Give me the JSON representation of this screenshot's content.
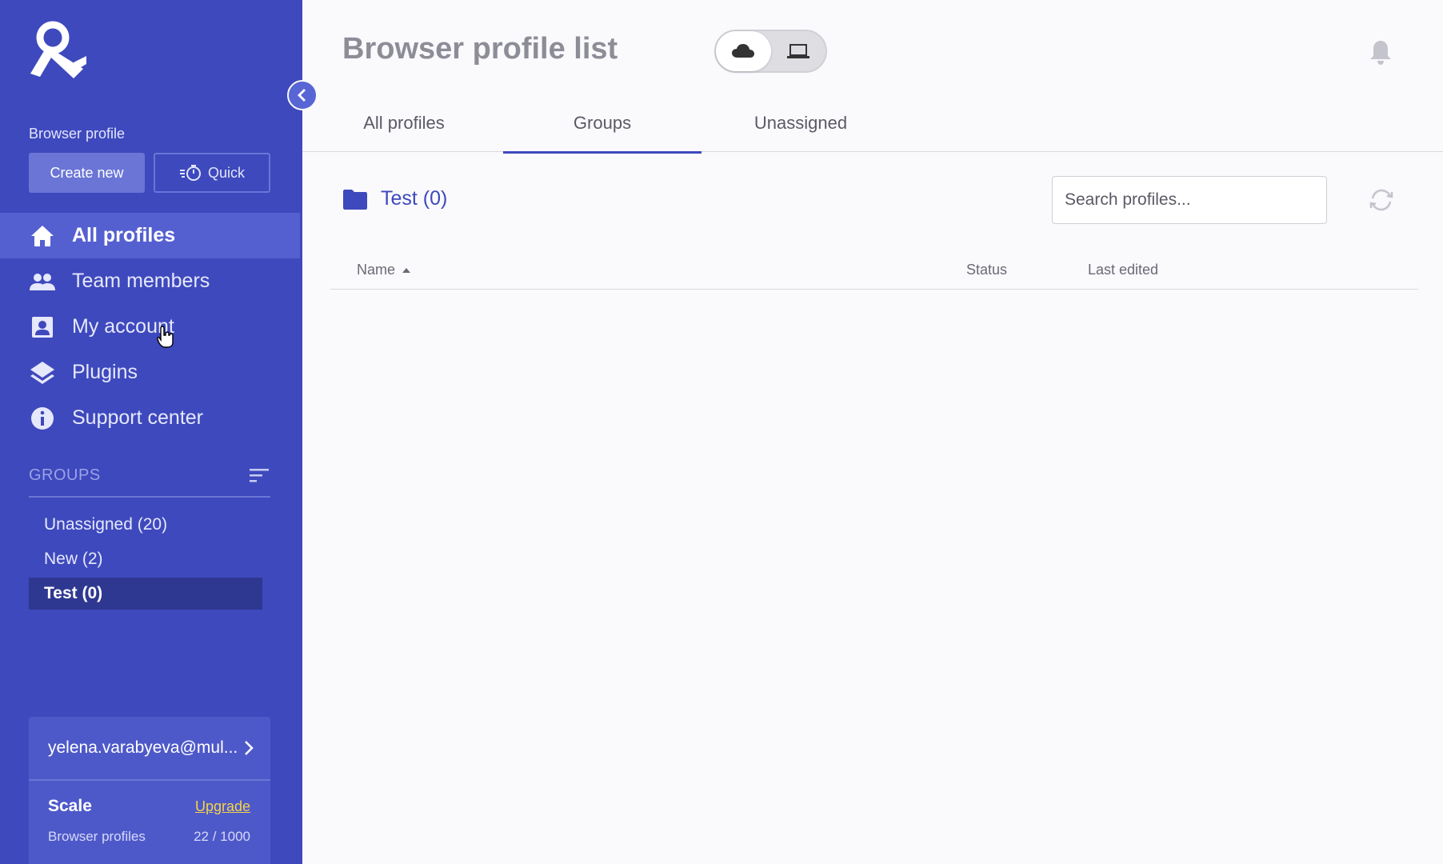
{
  "sidebar": {
    "section_label": "Browser profile",
    "create_new_label": "Create new",
    "quick_label": "Quick",
    "nav": [
      {
        "label": "All profiles",
        "icon": "home-icon",
        "active": true
      },
      {
        "label": "Team members",
        "icon": "team-icon",
        "active": false
      },
      {
        "label": "My account",
        "icon": "account-icon",
        "active": false
      },
      {
        "label": "Plugins",
        "icon": "layers-icon",
        "active": false
      },
      {
        "label": "Support center",
        "icon": "info-icon",
        "active": false
      }
    ],
    "groups_title": "GROUPS",
    "groups": [
      {
        "label": "Unassigned  (20)",
        "active": false
      },
      {
        "label": "New  (2)",
        "active": false
      },
      {
        "label": "Test  (0)",
        "active": true
      }
    ],
    "account_email": "yelena.varabyeva@mul...",
    "plan_name": "Scale",
    "upgrade_label": "Upgrade",
    "usage_label": "Browser profiles",
    "usage_value": "22 / 1000"
  },
  "header": {
    "title": "Browser profile list"
  },
  "tabs": [
    {
      "label": "All profiles",
      "active": false
    },
    {
      "label": "Groups",
      "active": true
    },
    {
      "label": "Unassigned",
      "active": false
    }
  ],
  "main": {
    "group_heading": "Test (0)",
    "search_placeholder": "Search profiles..."
  },
  "table": {
    "columns": [
      "Name",
      "Status",
      "Last edited"
    ]
  },
  "colors": {
    "sidebar_bg": "#3e49bd",
    "accent": "#3e49bd",
    "upgrade_link": "#f4d34a"
  }
}
